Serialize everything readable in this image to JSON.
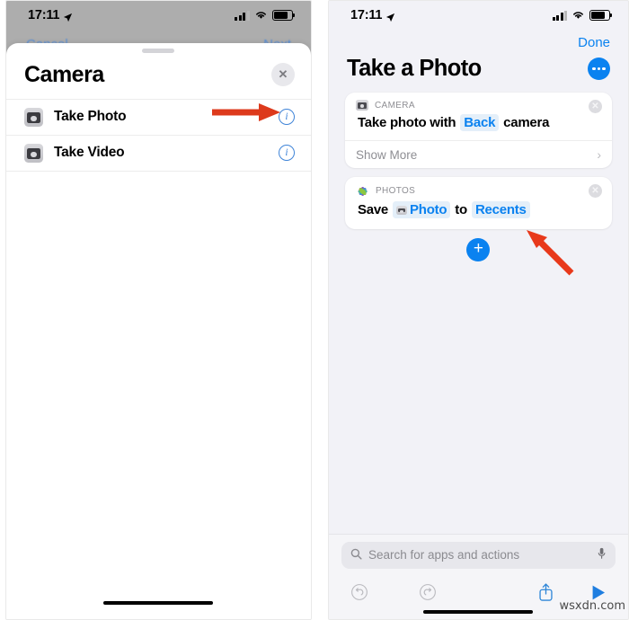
{
  "left_phone": {
    "status_bar": {
      "time": "17:11",
      "location_icon": "location-arrow-icon",
      "signal_icon": "cellular-signal-icon",
      "wifi_icon": "wifi-icon",
      "battery_icon": "battery-icon"
    },
    "background_nav": {
      "cancel_label": "Cancel",
      "next_label": "Next"
    },
    "sheet": {
      "title": "Camera",
      "close_label": "✕",
      "rows": [
        {
          "icon": "camera-app-icon",
          "label": "Take Photo",
          "info_label": "i"
        },
        {
          "icon": "camera-app-icon",
          "label": "Take Video",
          "info_label": "i"
        }
      ]
    }
  },
  "right_phone": {
    "status_bar": {
      "time": "17:11",
      "location_icon": "location-arrow-icon",
      "signal_icon": "cellular-signal-icon",
      "wifi_icon": "wifi-icon",
      "battery_icon": "battery-icon"
    },
    "done_label": "Done",
    "title": "Take a Photo",
    "more_button": "more-options-icon",
    "cards": [
      {
        "app": "CAMERA",
        "app_icon": "camera-app-icon",
        "close_label": "✕",
        "text_parts": [
          {
            "type": "plain",
            "text": "Take photo with"
          },
          {
            "type": "token",
            "text": "Back"
          },
          {
            "type": "plain",
            "text": "camera"
          }
        ],
        "show_more_label": "Show More",
        "chevron": "›"
      },
      {
        "app": "PHOTOS",
        "app_icon": "photos-app-icon",
        "close_label": "✕",
        "text_parts": [
          {
            "type": "plain",
            "text": "Save"
          },
          {
            "type": "token",
            "text": "Photo",
            "icon": "camera-glyph"
          },
          {
            "type": "plain",
            "text": "to"
          },
          {
            "type": "token",
            "text": "Recents"
          }
        ]
      }
    ],
    "add_button_label": "+",
    "search": {
      "icon": "search-icon",
      "placeholder": "Search for apps and actions",
      "mic_icon": "microphone-icon"
    },
    "toolbar": [
      {
        "name": "undo-button",
        "icon": "undo-icon",
        "state": "disabled"
      },
      {
        "name": "redo-button",
        "icon": "redo-icon",
        "state": "disabled"
      },
      {
        "name": "share-button",
        "icon": "share-icon",
        "state": "enabled"
      },
      {
        "name": "run-button",
        "icon": "play-icon",
        "state": "enabled"
      }
    ]
  },
  "annotations": [
    {
      "name": "arrow-to-info-button",
      "direction": "right",
      "color": "#d8391b"
    },
    {
      "name": "arrow-to-recents-token",
      "direction": "up-left",
      "color": "#e8391b"
    }
  ],
  "watermark": "wsxdn.com",
  "colors": {
    "accent_blue": "#0a82f0",
    "token_blue_bg": "#e4eff9",
    "arrow_red": "#dd3a1c",
    "sheet_dim": "#adadad",
    "page_bg": "#f2f2f7"
  }
}
